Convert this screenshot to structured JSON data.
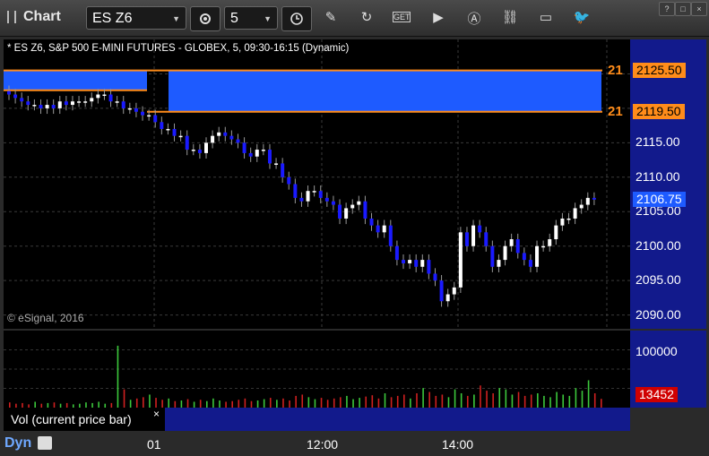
{
  "toolbar": {
    "title": "Chart",
    "symbol": "ES Z6",
    "interval": "5",
    "caret": "▼"
  },
  "chart": {
    "title": "* ES Z6, S&P 500 E-MINI FUTURES - GLOBEX, 5, 09:30-16:15 (Dynamic)",
    "copyright": "© eSignal, 2016",
    "price_labels": [
      "2115.00",
      "2110.00",
      "2105.00",
      "2100.00",
      "2095.00",
      "2090.00"
    ],
    "upper_tag": "2125.50",
    "lower_tag": "2119.50",
    "upper_stub": "21",
    "lower_stub": "21",
    "current_price": "2106.75",
    "vol_label_top": "100000",
    "vol_current": "13452",
    "vol_legend": "Vol (current price bar)",
    "legend_close": "×",
    "x_labels": [
      "01",
      "12:00",
      "14:00"
    ],
    "bottom_label": "Dyn",
    "colors": {
      "up": "#ffffff",
      "down": "#1a1aff",
      "zone": "#1e5bff",
      "zone_line": "#ff8c1a",
      "vol_up": "#3cc83c",
      "vol_down": "#d02020",
      "axis_bg": "#121a8c"
    }
  },
  "chart_data": {
    "type": "candlestick",
    "ylim": [
      2088,
      2130
    ],
    "price_zone": [
      2119.5,
      2125.5
    ],
    "close": [
      2122,
      2121.5,
      2121,
      2120.5,
      2120.5,
      2120,
      2120.5,
      2120,
      2121,
      2120.5,
      2121,
      2121,
      2121,
      2121.5,
      2122,
      2122,
      2121,
      2121,
      2120,
      2120,
      2119.5,
      2119,
      2119,
      2118,
      2117,
      2117,
      2116,
      2116,
      2114,
      2114,
      2113.5,
      2115,
      2116,
      2116.5,
      2116,
      2115.5,
      2115,
      2113.5,
      2113,
      2114,
      2114,
      2112,
      2112,
      2110,
      2109,
      2107,
      2106.5,
      2108,
      2108,
      2107,
      2106.5,
      2106,
      2104,
      2105.5,
      2106,
      2106.5,
      2104,
      2103,
      2102,
      2103,
      2100,
      2098,
      2097.5,
      2098,
      2097,
      2098,
      2096,
      2095,
      2092,
      2093,
      2094,
      2102,
      2100,
      2103,
      2102,
      2100,
      2097,
      2098,
      2100,
      2101,
      2099,
      2098,
      2097,
      2100,
      2100,
      2101,
      2103,
      2104,
      2104,
      2105.5,
      2106,
      2107,
      2106.75
    ],
    "volume": [
      8,
      6,
      7,
      5,
      9,
      6,
      7,
      8,
      6,
      7,
      5,
      6,
      8,
      7,
      9,
      6,
      7,
      95,
      28,
      12,
      14,
      16,
      20,
      15,
      12,
      14,
      10,
      11,
      13,
      9,
      12,
      10,
      14,
      11,
      9,
      10,
      12,
      14,
      10,
      11,
      13,
      15,
      12,
      14,
      11,
      18,
      20,
      16,
      13,
      15,
      12,
      14,
      16,
      18,
      13,
      15,
      17,
      19,
      14,
      22,
      16,
      18,
      20,
      14,
      22,
      30,
      24,
      18,
      20,
      16,
      28,
      22,
      18,
      20,
      34,
      26,
      22,
      30,
      28,
      20,
      24,
      18,
      20,
      22,
      18,
      16,
      24,
      20,
      18,
      30,
      26,
      42,
      22,
      13.452
    ],
    "vol_ylim": [
      0,
      110
    ]
  }
}
